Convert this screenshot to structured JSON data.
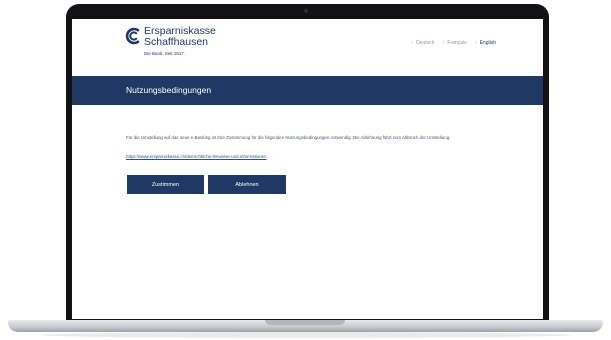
{
  "brand": {
    "name_line1": "Ersparniskasse",
    "name_line2": "Schaffhausen",
    "tagline": "Die Bank. Seit 1817.",
    "color": "#1f3964"
  },
  "languages": [
    {
      "label": "Deutsch",
      "active": false
    },
    {
      "label": "Français",
      "active": false
    },
    {
      "label": "English",
      "active": true
    }
  ],
  "page": {
    "title": "Nutzungsbedingungen",
    "info_text": "Für die Umstellung auf das neue e-Banking ist Ihre Zustimmung für die folgenden Nutzungsbedingungen notwendig. Die Ablehnung führt zum Abbruch der Umstellung.",
    "link_text": "https://www.ersparniskasse.ch/de/rechtliche-hinweise-und-informationen"
  },
  "buttons": {
    "accept_label": "Zustimmen",
    "decline_label": "Ablehnen"
  }
}
